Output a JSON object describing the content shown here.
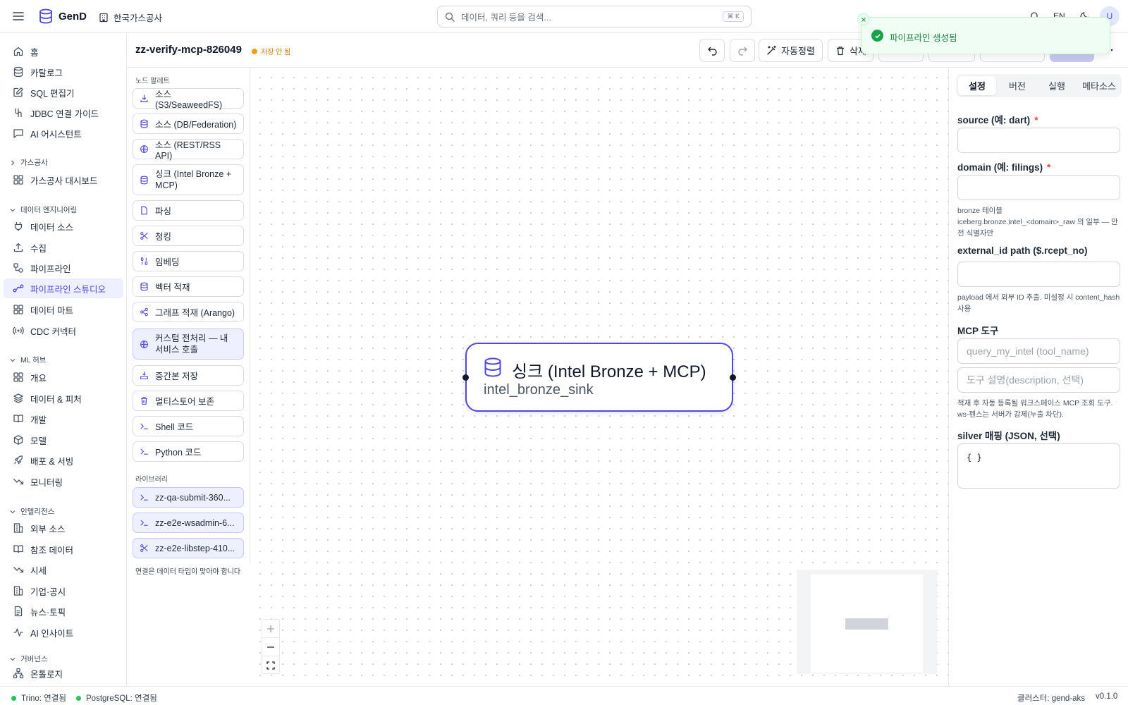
{
  "app": {
    "brand": "GenD",
    "org": "한국가스공사",
    "search_placeholder": "데이터, 쿼리 등을 검색...",
    "search_shortcut": "⌘ K",
    "lang": "EN",
    "avatar": "U"
  },
  "sidebar": {
    "top": [
      "홈",
      "카탈로그",
      "SQL 편집기",
      "JDBC 연결 가이드",
      "AI 어시스턴트"
    ],
    "sections": {
      "gas": "가스공사",
      "de": "데이터 엔지니어링",
      "ml": "ML 허브",
      "intel": "인텔리전스",
      "gov": "거버넌스"
    },
    "gas_items": [
      "가스공사 대시보드"
    ],
    "de_items": [
      "데이터 소스",
      "수집",
      "파이프라인",
      "파이프라인 스튜디오",
      "데이터 마트",
      "CDC 커넥터"
    ],
    "ml_items": [
      "개요",
      "데이터 & 피처",
      "개발",
      "모델",
      "배포 & 서빙",
      "모니터링"
    ],
    "intel_items": [
      "외부 소스",
      "참조 데이터",
      "시세",
      "기업·공시",
      "뉴스·토픽",
      "AI 인사이트"
    ],
    "gov_items": [
      "온톨로지"
    ],
    "active": "파이프라인 스튜디오"
  },
  "header": {
    "pipeline_name": "zz-verify-mcp-826049",
    "unsaved": "저장 안 됨",
    "autolayout": "자동정렬",
    "delete": "삭제"
  },
  "toast": {
    "message": "파이프라인 생성됨"
  },
  "palette": {
    "title": "노드 팔레트",
    "items": [
      "소스 (S3/SeaweedFS)",
      "소스 (DB/Federation)",
      "소스 (REST/RSS API)",
      "싱크 (Intel Bronze + MCP)",
      "파싱",
      "청킹",
      "임베딩",
      "벡터 적재",
      "그래프 적재 (Arango)",
      "커스텀 전처리 — 내 서비스 호출",
      "중간본 저장",
      "멀티스토어 보존",
      "Shell 코드",
      "Python 코드"
    ],
    "library_title": "라이브러리",
    "library": [
      "zz-qa-submit-360...",
      "zz-e2e-wsadmin-6...",
      "zz-e2e-libstep-410..."
    ],
    "note": "연결은 데이터 타입이 맞아야 합니다"
  },
  "node": {
    "title": "싱크 (Intel Bronze + MCP)",
    "subtitle": "intel_bronze_sink"
  },
  "panel": {
    "tabs": [
      "설정",
      "버전",
      "실행",
      "메타소스"
    ],
    "active_tab": "설정",
    "source_label": "source (예: dart)",
    "domain_label": "domain (예: filings)",
    "req": "*",
    "domain_help": "bronze 테이블 iceberg.bronze.intel_<domain>_raw 의 일부 — 안전 식별자만",
    "extid_label": "external_id path ($.rcept_no)",
    "extid_help": "payload 에서 외부 ID 추출. 미설정 시 content_hash 사용",
    "mcp_label": "MCP 도구",
    "mcp_tool_placeholder": "query_my_intel (tool_name)",
    "mcp_desc_placeholder": "도구 설명(description, 선택)",
    "mcp_help": "적재 후 자동 등록될 워크스페이스 MCP 조회 도구. ws-펜스는 서버가 강제(누출 차단).",
    "silver_label": "silver 매핑 (JSON, 선택)",
    "silver_value": "{ }"
  },
  "status": {
    "trino": "Trino: 연결됨",
    "pg": "PostgreSQL: 연결됨",
    "cluster": "클러스터: gend-aks",
    "version": "v0.1.0"
  }
}
